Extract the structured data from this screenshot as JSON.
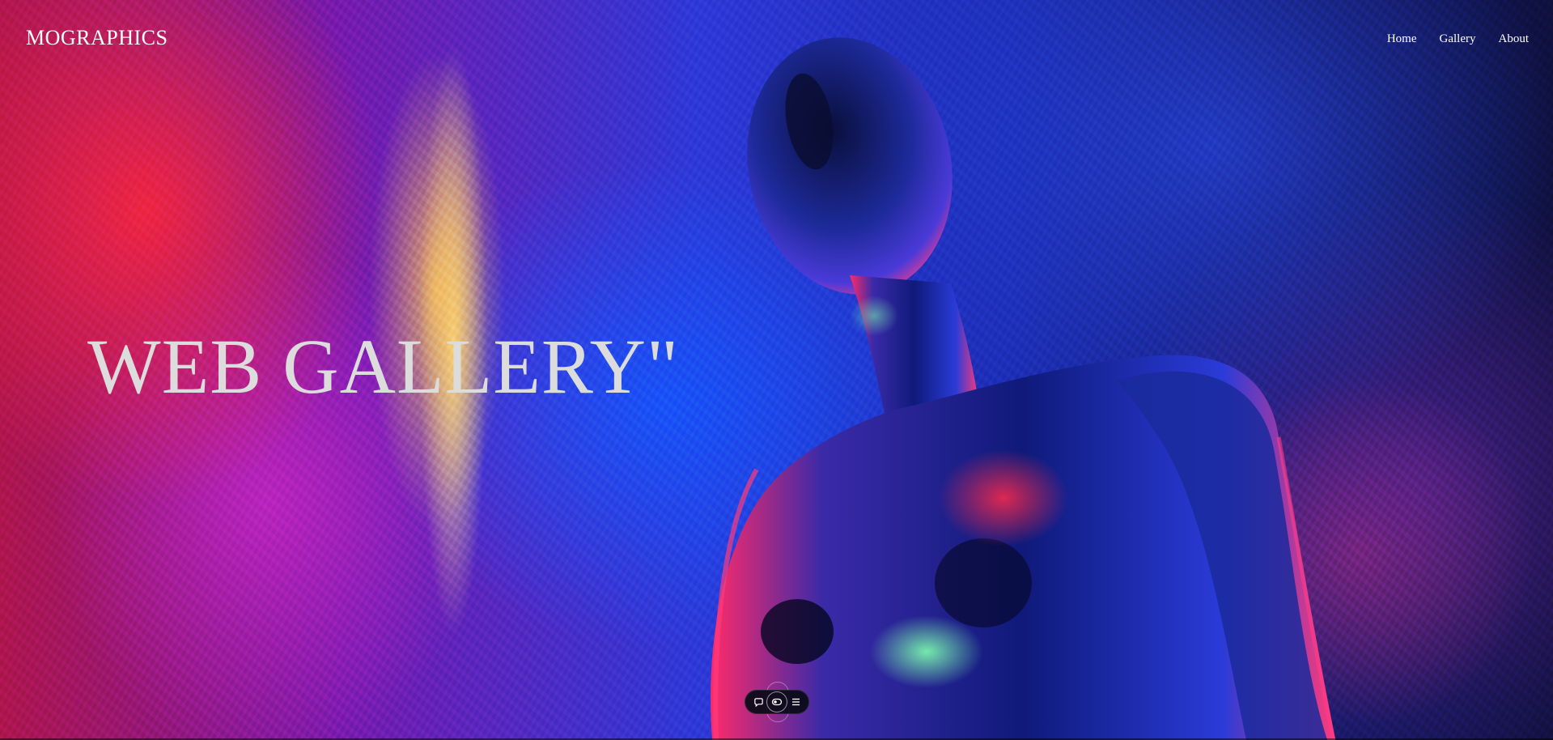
{
  "site": {
    "logo": "MOGRAPHICS",
    "nav": [
      {
        "label": "Home"
      },
      {
        "label": "Gallery"
      },
      {
        "label": "About"
      }
    ]
  },
  "hero": {
    "title": "WEB GALLERY\"",
    "background_image": "neon-foil-mannequin",
    "accent_colors": [
      "#ff2a4a",
      "#7a1bb0",
      "#2f3ad8",
      "#ffd27a"
    ]
  },
  "toolbar": {
    "buttons": [
      {
        "icon": "chat-bubble-icon"
      },
      {
        "icon": "toggle-icon"
      },
      {
        "icon": "menu-icon"
      }
    ]
  }
}
